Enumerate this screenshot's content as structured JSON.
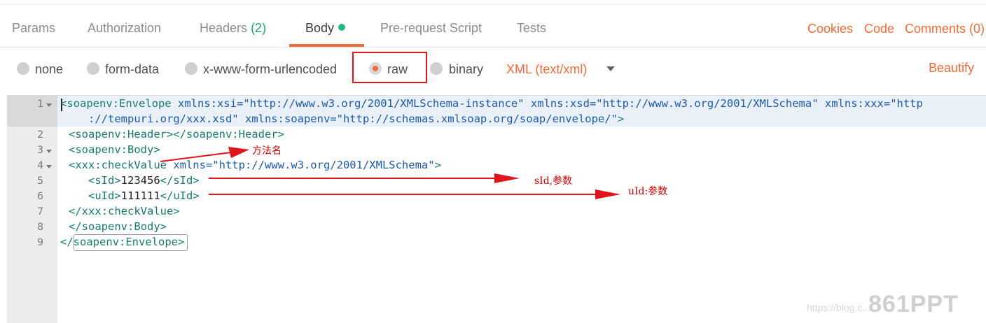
{
  "request_tabs": [
    {
      "label": "Params"
    },
    {
      "label": "Authorization"
    },
    {
      "label": "Headers",
      "count": "(2)"
    },
    {
      "label": "Body"
    },
    {
      "label": "Pre-request Script"
    },
    {
      "label": "Tests"
    }
  ],
  "right_links": {
    "cookies": "Cookies",
    "code": "Code",
    "comments": "Comments (0)"
  },
  "body_types": [
    {
      "label": "none"
    },
    {
      "label": "form-data"
    },
    {
      "label": "x-www-form-urlencoded"
    },
    {
      "label": "raw",
      "selected": true
    },
    {
      "label": "binary"
    }
  ],
  "content_type": "XML (text/xml)",
  "beautify": "Beautify",
  "editor": {
    "line_numbers": [
      "1",
      "2",
      "3",
      "4",
      "5",
      "6",
      "7",
      "8",
      "9"
    ],
    "lines": {
      "l1a_tag": "<soapenv:Envelope ",
      "l1a_attr1": "xmlns:xsi=",
      "l1a_val1": "\"http://www.w3.org/2001/XMLSchema-instance\"",
      "l1a_attr2": " xmlns:xsd=",
      "l1a_val2": "\"http://www.w3.org/2001/XMLSchema\"",
      "l1a_attr3": " xmlns:xxx=",
      "l1a_val3": "\"http",
      "l1b_val3": "://tempuri.org/xxx.xsd\"",
      "l1b_attr4": " xmlns:soapenv=",
      "l1b_val4": "\"http://schemas.xmlsoap.org/soap/envelope/\"",
      "l1b_close": ">",
      "l2": "<soapenv:Header></soapenv:Header>",
      "l3": "<soapenv:Body>",
      "l4_tag": "<xxx:checkValue ",
      "l4_attr": "xmlns=",
      "l4_val": "\"http://www.w3.org/2001/XMLSchema\"",
      "l4_close": ">",
      "l5_open": "<sId>",
      "l5_text": "123456",
      "l5_close": "</sId>",
      "l6_open": "<uId>",
      "l6_text": "111111",
      "l6_close": "</uId>",
      "l7": "</xxx:checkValue>",
      "l8": "</soapenv:Body>",
      "l9_open": "</",
      "l9_name": "soapenv:Envelope",
      "l9_close": ">"
    }
  },
  "annotations": {
    "method_name": "方法名",
    "sid_param": "sId,参数",
    "uid_param": "uId:参数"
  },
  "watermark": {
    "url": "https://blog.c...",
    "logo": "861PPT"
  },
  "colors": {
    "accent": "#f26b3a",
    "active_dot": "#26b47f",
    "annotation_red": "#cc0000"
  }
}
